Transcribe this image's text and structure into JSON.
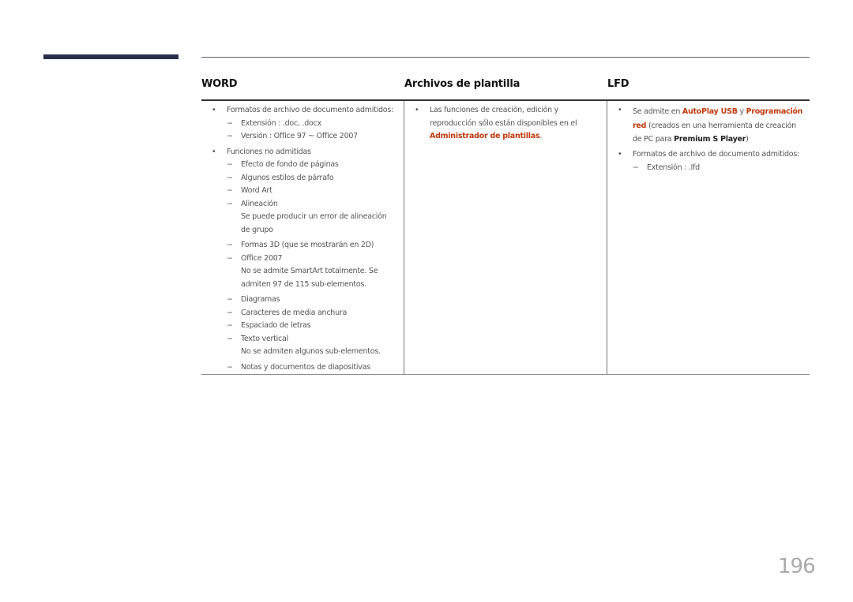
{
  "headers": {
    "word": "WORD",
    "templates": "Archivos de plantilla",
    "lfd": "LFD"
  },
  "word": {
    "b1": "Formatos de archivo de documento admitidos:",
    "b1_subs": [
      "Extensión : .doc, .docx",
      "Versión : Office 97 ~ Office 2007"
    ],
    "b2": "Funciones no admitidas",
    "s1": "Efecto de fondo de páginas",
    "s2": "Algunos estilos de párrafo",
    "s3": "Word Art",
    "s4": "Alineación",
    "s4_note1": "Se puede producir un error de alineación",
    "s4_note2": "de grupo",
    "s5": "Formas 3D (que se mostrarán en 2D)",
    "s6": "Office 2007",
    "s6_note1": "No se admite SmartArt totalmente. Se",
    "s6_note2": "admiten 97 de 115 sub-elementos.",
    "s7": "Diagramas",
    "s8": "Caracteres de media anchura",
    "s9": "Espaciado de letras",
    "s10": "Texto vertical",
    "s10_note": "No se admiten algunos sub-elementos.",
    "s11": "Notas y documentos de diapositivas"
  },
  "templates": {
    "line1": "Las funciones de creación, edición y",
    "line2": "reproducción sólo están disponibles en el",
    "highlight": "Administrador de plantillas",
    "tail": "."
  },
  "lfd": {
    "b1_pre": "Se admite en ",
    "b1_hl1": "AutoPlay USB",
    "b1_mid": " y ",
    "b1_hl2a": "Programación",
    "b1_hl2b": "red",
    "b1_post1": " (creados en una herramienta de creación",
    "b1_post2": "de PC para ",
    "b1_bold": "Premium S Player",
    "b1_end": ")",
    "b2": "Formatos de archivo de documento admitidos:",
    "b2_sub": "Extensión : .lfd"
  },
  "bullet": "•",
  "dash": "−",
  "page_number": "196",
  "colors": {
    "accent": "#c23a0d",
    "bar": "#2a3048"
  }
}
